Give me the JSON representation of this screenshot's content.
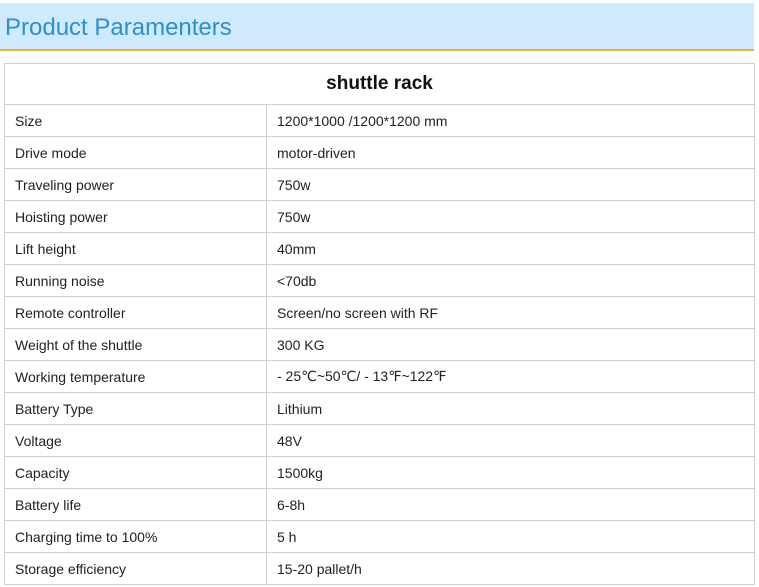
{
  "header": {
    "title": "Product Paramenters"
  },
  "table": {
    "title": "shuttle rack",
    "rows": [
      {
        "label": "Size",
        "value": "1200*1000 /1200*1200 mm"
      },
      {
        "label": "Drive mode",
        "value": "motor-driven"
      },
      {
        "label": "Traveling power",
        "value": "750w"
      },
      {
        "label": "Hoisting power",
        "value": "750w"
      },
      {
        "label": "Lift height",
        "value": "40mm"
      },
      {
        "label": "Running noise",
        "value": "<70db"
      },
      {
        "label": "Remote controller",
        "value": "Screen/no screen with RF"
      },
      {
        "label": "Weight of the shuttle",
        "value": "300 KG"
      },
      {
        "label": "Working temperature",
        "value": " - 25℃~50℃/  - 13℉~122℉"
      },
      {
        "label": "Battery Type",
        "value": "Lithium"
      },
      {
        "label": "Voltage",
        "value": "48V"
      },
      {
        "label": "Capacity",
        "value": "1500kg"
      },
      {
        "label": "Battery life",
        "value": "6-8h"
      },
      {
        "label": "Charging time to 100%",
        "value": "5 h"
      },
      {
        "label": "Storage efficiency",
        "value": "15-20 pallet/h"
      }
    ]
  },
  "colors": {
    "header_bg": "#cfeafc",
    "header_text": "#2b8fd3",
    "header_underline": "#e0b830",
    "border": "#cfcfcf"
  }
}
